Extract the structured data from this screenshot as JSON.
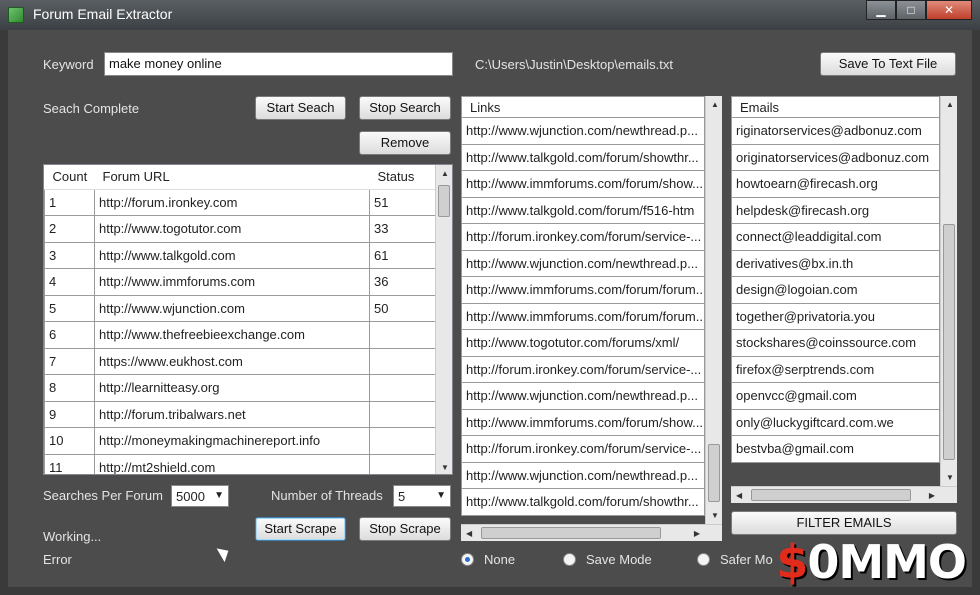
{
  "window": {
    "title": "Forum Email Extractor",
    "buttons": {
      "minimize": "▁",
      "maximize": "□",
      "close": "✕"
    }
  },
  "keyword": {
    "label": "Keyword",
    "value": "make money online"
  },
  "output_path": "C:\\Users\\Justin\\Desktop\\emails.txt",
  "buttons": {
    "save_to_text_file": "Save To Text File",
    "start_seach": "Start Seach",
    "stop_search": "Stop Search",
    "remove": "Remove",
    "start_scrape": "Start Scrape",
    "stop_scrape": "Stop Scrape",
    "filter_emails": "FILTER EMAILS"
  },
  "status": {
    "search": "Seach Complete",
    "working": "Working...",
    "error": "Error"
  },
  "forums_table": {
    "headers": [
      "Count",
      "Forum URL",
      "Status"
    ],
    "rows": [
      [
        "1",
        "http://forum.ironkey.com",
        "51"
      ],
      [
        "2",
        "http://www.togotutor.com",
        "33"
      ],
      [
        "3",
        "http://www.talkgold.com",
        "61"
      ],
      [
        "4",
        "http://www.immforums.com",
        "36"
      ],
      [
        "5",
        "http://www.wjunction.com",
        "50"
      ],
      [
        "6",
        "http://www.thefreebieexchange.com",
        ""
      ],
      [
        "7",
        "https://www.eukhost.com",
        ""
      ],
      [
        "8",
        "http://learnitteasy.org",
        ""
      ],
      [
        "9",
        "http://forum.tribalwars.net",
        ""
      ],
      [
        "10",
        "http://moneymakingmachinereport.info",
        ""
      ],
      [
        "11",
        "http://mt2shield.com",
        ""
      ]
    ]
  },
  "searches_per_forum": {
    "label": "Searches Per Forum",
    "value": "5000"
  },
  "threads": {
    "label": "Number of Threads",
    "value": "5"
  },
  "links": {
    "header": "Links",
    "items": [
      "http://www.wjunction.com/newthread.p...",
      "http://www.talkgold.com/forum/showthr...",
      "http://www.immforums.com/forum/show...",
      "http://www.talkgold.com/forum/f516-htm",
      "http://forum.ironkey.com/forum/service-...",
      "http://www.wjunction.com/newthread.p...",
      "http://www.immforums.com/forum/forum...",
      "http://www.immforums.com/forum/forum...",
      "http://www.togotutor.com/forums/xml/",
      "http://forum.ironkey.com/forum/service-...",
      "http://www.wjunction.com/newthread.p...",
      "http://www.immforums.com/forum/show...",
      "http://forum.ironkey.com/forum/service-...",
      "http://www.wjunction.com/newthread.p...",
      "http://www.talkgold.com/forum/showthr..."
    ]
  },
  "emails": {
    "header": "Emails",
    "items": [
      "riginatorservices@adbonuz.com",
      "originatorservices@adbonuz.com",
      "howtoearn@firecash.org",
      "helpdesk@firecash.org",
      "connect@leaddigital.com",
      "derivatives@bx.in.th",
      "design@logoian.com",
      "together@privatoria.you",
      "stockshares@coinssource.com",
      "firefox@serptrends.com",
      "openvcc@gmail.com",
      "only@luckygiftcard.com.we",
      "bestvba@gmail.com"
    ]
  },
  "modes": {
    "options": [
      "None",
      "Save Mode",
      "Safer Mo"
    ],
    "selected": "None"
  },
  "watermark": "$0MMO",
  "colors": {
    "client_bg": "#4c4c4c",
    "accent": "#2a6bd1"
  }
}
